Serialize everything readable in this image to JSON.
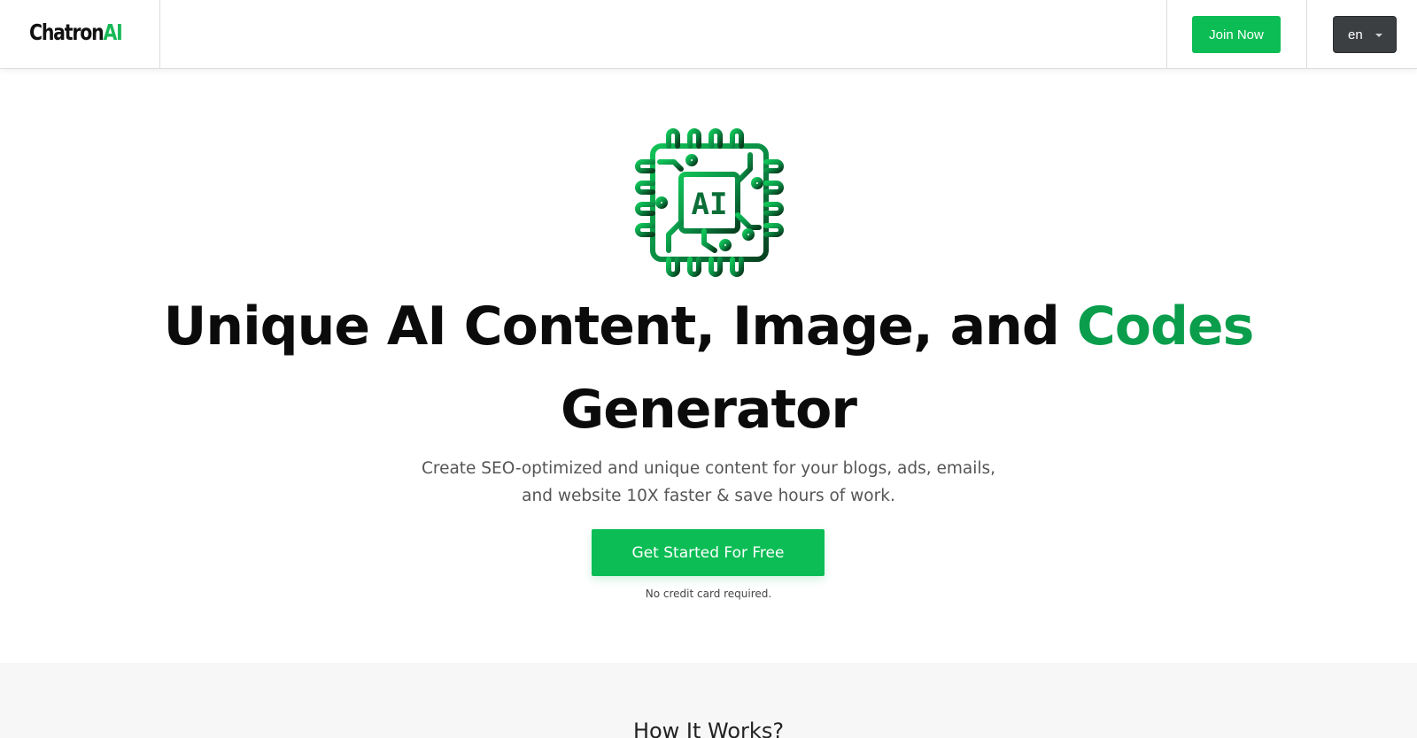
{
  "header": {
    "logo_text": "Chatron",
    "logo_accent": "AI",
    "join_label": "Join Now",
    "language": "en"
  },
  "hero": {
    "icon": "ai-chip-icon",
    "icon_label": "AI",
    "headline_main": "Unique AI Content, Image, and",
    "headline_accent": "Codes",
    "headline_line2": "Generator",
    "subtitle": "Create SEO-optimized and unique content for your blogs, ads, emails, and website 10X faster & save hours of work.",
    "cta_label": "Get Started For Free",
    "note": "No credit card required."
  },
  "how_it_works": {
    "title": "How It Works?"
  },
  "colors": {
    "brand_green": "#0cbd55",
    "headline_accent": "#0a9e4c",
    "language_button": "#3c3f42"
  }
}
